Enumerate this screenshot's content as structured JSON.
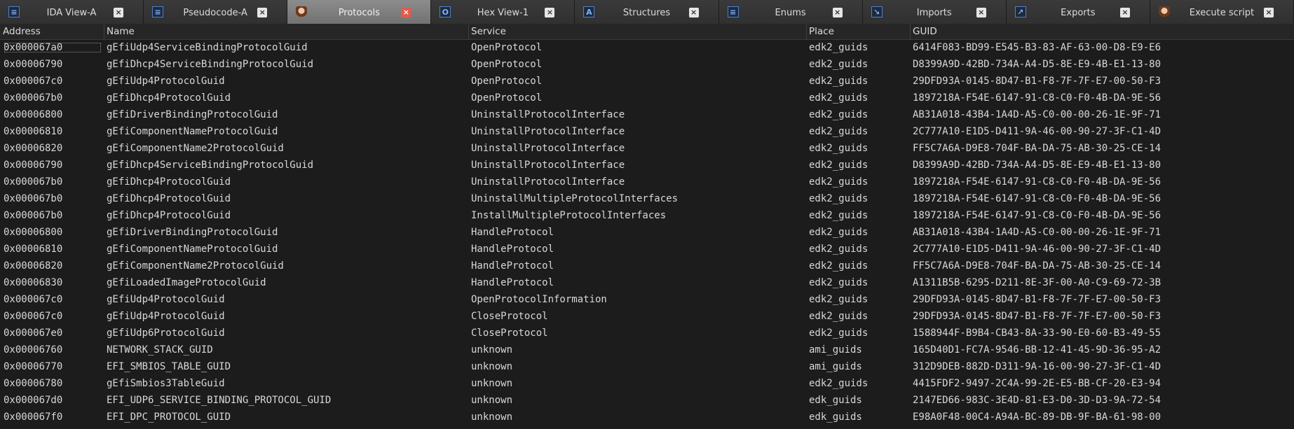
{
  "tabs": [
    {
      "label": "IDA View-A",
      "icon": "ida-view-icon",
      "glyph": "≡",
      "active": false
    },
    {
      "label": "Pseudocode-A",
      "icon": "pseudocode-icon",
      "glyph": "≡",
      "active": false
    },
    {
      "label": "Protocols",
      "icon": "plugin-avatar-icon",
      "glyph": "",
      "active": true
    },
    {
      "label": "Hex View-1",
      "icon": "hex-view-icon",
      "glyph": "O",
      "active": false
    },
    {
      "label": "Structures",
      "icon": "structures-icon",
      "glyph": "A",
      "active": false
    },
    {
      "label": "Enums",
      "icon": "enums-icon",
      "glyph": "≡",
      "active": false
    },
    {
      "label": "Imports",
      "icon": "imports-icon",
      "glyph": "↘",
      "active": false
    },
    {
      "label": "Exports",
      "icon": "exports-icon",
      "glyph": "↗",
      "active": false
    },
    {
      "label": "Execute script",
      "icon": "execute-script-icon",
      "glyph": "",
      "active": false
    }
  ],
  "columns": [
    "Address",
    "Name",
    "Service",
    "Place",
    "GUID"
  ],
  "rows": [
    [
      "0x000067a0",
      "gEfiUdp4ServiceBindingProtocolGuid",
      "OpenProtocol",
      "edk2_guids",
      "6414F083-BD99-E545-B3-83-AF-63-00-D8-E9-E6"
    ],
    [
      "0x00006790",
      "gEfiDhcp4ServiceBindingProtocolGuid",
      "OpenProtocol",
      "edk2_guids",
      "D8399A9D-42BD-734A-A4-D5-8E-E9-4B-E1-13-80"
    ],
    [
      "0x000067c0",
      "gEfiUdp4ProtocolGuid",
      "OpenProtocol",
      "edk2_guids",
      "29DFD93A-0145-8D47-B1-F8-7F-7F-E7-00-50-F3"
    ],
    [
      "0x000067b0",
      "gEfiDhcp4ProtocolGuid",
      "OpenProtocol",
      "edk2_guids",
      "1897218A-F54E-6147-91-C8-C0-F0-4B-DA-9E-56"
    ],
    [
      "0x00006800",
      "gEfiDriverBindingProtocolGuid",
      "UninstallProtocolInterface",
      "edk2_guids",
      "AB31A018-43B4-1A4D-A5-C0-00-00-26-1E-9F-71"
    ],
    [
      "0x00006810",
      "gEfiComponentNameProtocolGuid",
      "UninstallProtocolInterface",
      "edk2_guids",
      "2C777A10-E1D5-D411-9A-46-00-90-27-3F-C1-4D"
    ],
    [
      "0x00006820",
      "gEfiComponentName2ProtocolGuid",
      "UninstallProtocolInterface",
      "edk2_guids",
      "FF5C7A6A-D9E8-704F-BA-DA-75-AB-30-25-CE-14"
    ],
    [
      "0x00006790",
      "gEfiDhcp4ServiceBindingProtocolGuid",
      "UninstallProtocolInterface",
      "edk2_guids",
      "D8399A9D-42BD-734A-A4-D5-8E-E9-4B-E1-13-80"
    ],
    [
      "0x000067b0",
      "gEfiDhcp4ProtocolGuid",
      "UninstallProtocolInterface",
      "edk2_guids",
      "1897218A-F54E-6147-91-C8-C0-F0-4B-DA-9E-56"
    ],
    [
      "0x000067b0",
      "gEfiDhcp4ProtocolGuid",
      "UninstallMultipleProtocolInterfaces",
      "edk2_guids",
      "1897218A-F54E-6147-91-C8-C0-F0-4B-DA-9E-56"
    ],
    [
      "0x000067b0",
      "gEfiDhcp4ProtocolGuid",
      "InstallMultipleProtocolInterfaces",
      "edk2_guids",
      "1897218A-F54E-6147-91-C8-C0-F0-4B-DA-9E-56"
    ],
    [
      "0x00006800",
      "gEfiDriverBindingProtocolGuid",
      "HandleProtocol",
      "edk2_guids",
      "AB31A018-43B4-1A4D-A5-C0-00-00-26-1E-9F-71"
    ],
    [
      "0x00006810",
      "gEfiComponentNameProtocolGuid",
      "HandleProtocol",
      "edk2_guids",
      "2C777A10-E1D5-D411-9A-46-00-90-27-3F-C1-4D"
    ],
    [
      "0x00006820",
      "gEfiComponentName2ProtocolGuid",
      "HandleProtocol",
      "edk2_guids",
      "FF5C7A6A-D9E8-704F-BA-DA-75-AB-30-25-CE-14"
    ],
    [
      "0x00006830",
      "gEfiLoadedImageProtocolGuid",
      "HandleProtocol",
      "edk2_guids",
      "A1311B5B-6295-D211-8E-3F-00-A0-C9-69-72-3B"
    ],
    [
      "0x000067c0",
      "gEfiUdp4ProtocolGuid",
      "OpenProtocolInformation",
      "edk2_guids",
      "29DFD93A-0145-8D47-B1-F8-7F-7F-E7-00-50-F3"
    ],
    [
      "0x000067c0",
      "gEfiUdp4ProtocolGuid",
      "CloseProtocol",
      "edk2_guids",
      "29DFD93A-0145-8D47-B1-F8-7F-7F-E7-00-50-F3"
    ],
    [
      "0x000067e0",
      "gEfiUdp6ProtocolGuid",
      "CloseProtocol",
      "edk2_guids",
      "1588944F-B9B4-CB43-8A-33-90-E0-60-B3-49-55"
    ],
    [
      "0x00006760",
      "NETWORK_STACK_GUID",
      "unknown",
      "ami_guids",
      "165D40D1-FC7A-9546-BB-12-41-45-9D-36-95-A2"
    ],
    [
      "0x00006770",
      "EFI_SMBIOS_TABLE_GUID",
      "unknown",
      "ami_guids",
      "312D9DEB-882D-D311-9A-16-00-90-27-3F-C1-4D"
    ],
    [
      "0x00006780",
      "gEfiSmbios3TableGuid",
      "unknown",
      "edk2_guids",
      "4415FDF2-9497-2C4A-99-2E-E5-BB-CF-20-E3-94"
    ],
    [
      "0x000067d0",
      "EFI_UDP6_SERVICE_BINDING_PROTOCOL_GUID",
      "unknown",
      "edk_guids",
      "2147ED66-983C-3E4D-81-E3-D0-3D-D3-9A-72-54"
    ],
    [
      "0x000067f0",
      "EFI_DPC_PROTOCOL_GUID",
      "unknown",
      "edk_guids",
      "E98A0F48-00C4-A94A-BC-89-DB-9F-BA-61-98-00"
    ]
  ],
  "colors": {
    "background": "#1c1c1c",
    "text": "#d8d8d8",
    "active_tab": "#7a7a7a",
    "close_active": "#e45a4a"
  }
}
